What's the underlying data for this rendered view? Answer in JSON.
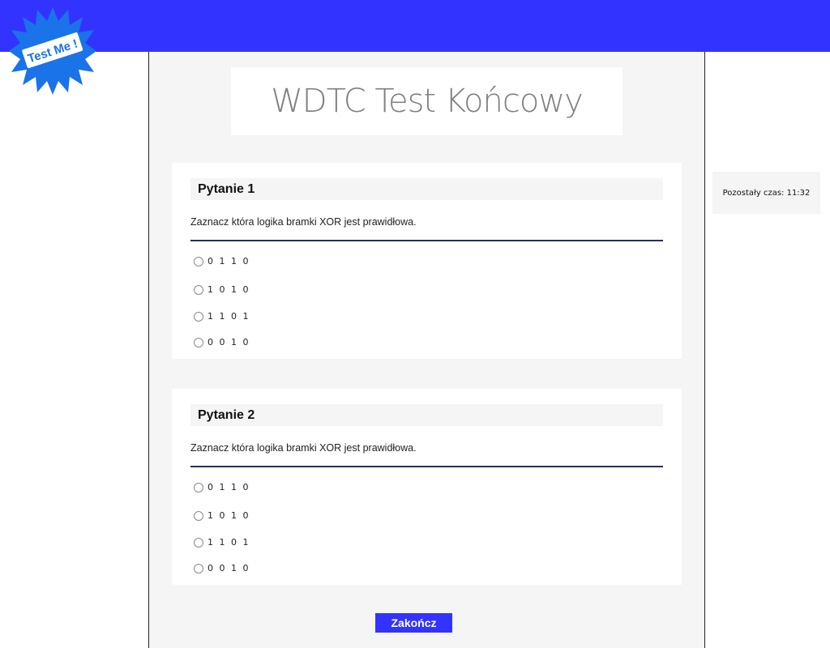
{
  "logo": {
    "text": "Test Me !",
    "color": "#1a73e8"
  },
  "header": {
    "bar_color": "#3333ff"
  },
  "page": {
    "title": "WDTC Test Końcowy"
  },
  "timer": {
    "label": "Pozostały czas: 11:32"
  },
  "questions": [
    {
      "heading": "Pytanie 1",
      "text": "Zaznacz która logika bramki XOR jest prawidłowa.",
      "options": [
        "0 1 1 0",
        "1 0 1 0",
        "1 1 0 1",
        "0 0 1 0"
      ]
    },
    {
      "heading": "Pytanie 2",
      "text": "Zaznacz która logika bramki XOR jest prawidłowa.",
      "options": [
        "0 1 1 0",
        "1 0 1 0",
        "1 1 0 1",
        "0 0 1 0"
      ]
    }
  ],
  "footer": {
    "finish_label": "Zakończ"
  }
}
